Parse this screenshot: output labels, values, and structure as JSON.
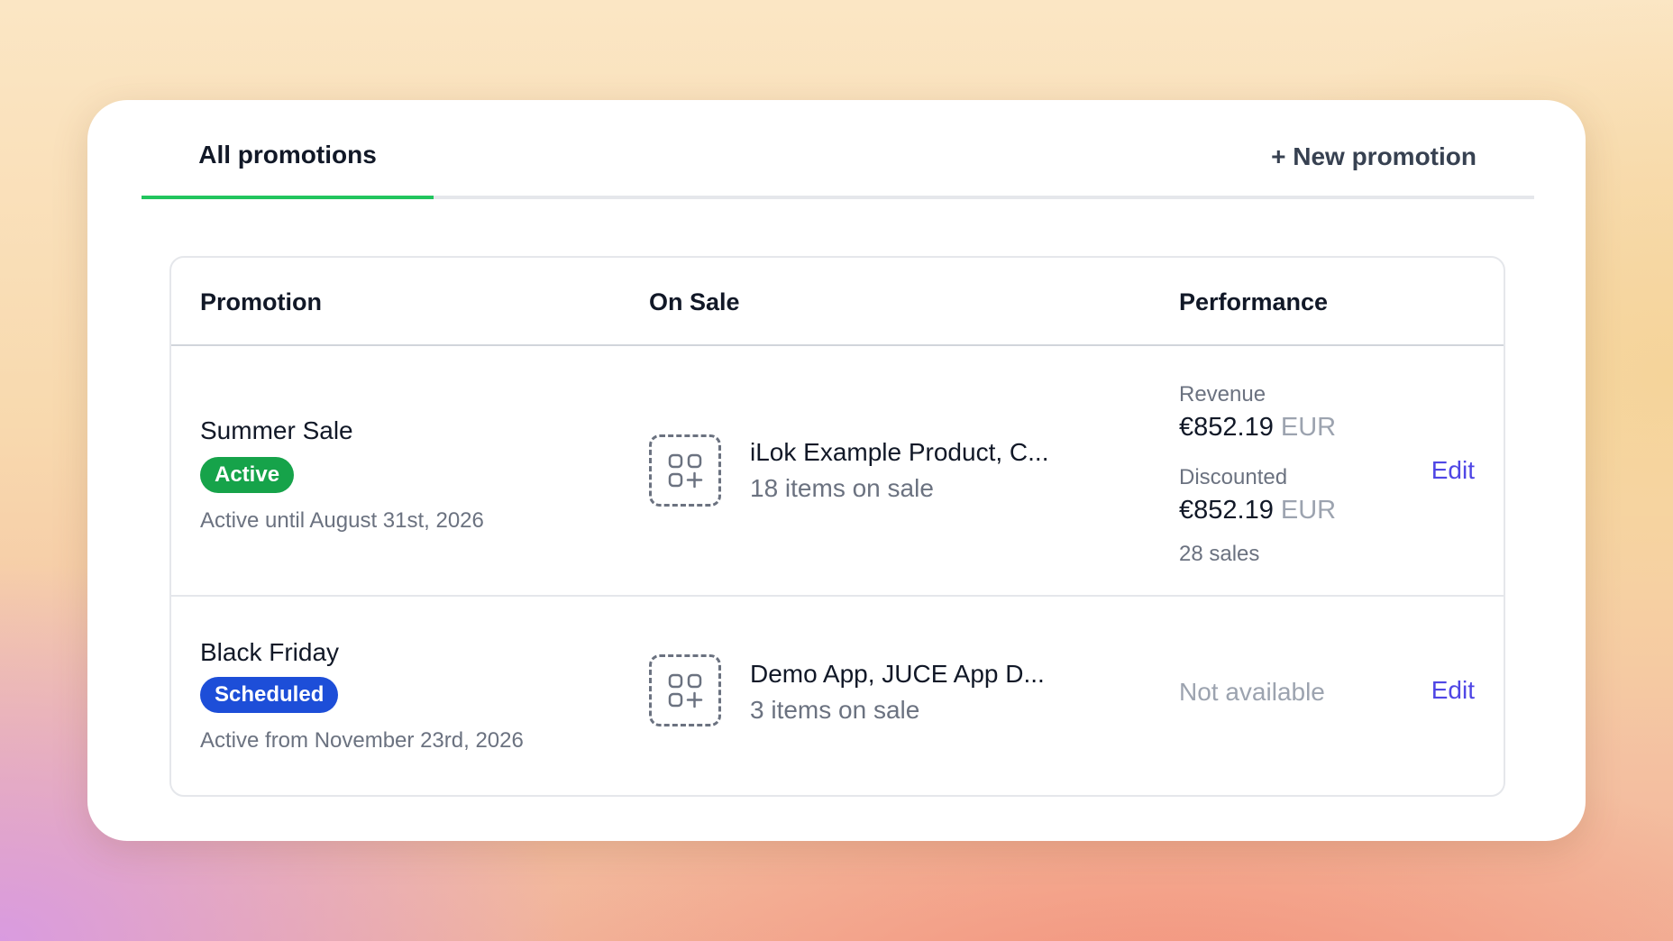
{
  "tabs": {
    "active_label": "All promotions",
    "new_promotion_label": "+ New promotion"
  },
  "table": {
    "headers": [
      "Promotion",
      "On Sale",
      "Performance"
    ],
    "rows": [
      {
        "name": "Summer Sale",
        "status": "Active",
        "status_color": "#16a34a",
        "date_text": "Active until August 31st, 2026",
        "product_icon": "add-grid-icon",
        "products": "iLok Example Product, C...",
        "items_on_sale": "18 items on sale",
        "revenue_label": "Revenue",
        "revenue_amount": "€852.19",
        "revenue_currency": "EUR",
        "discounted_label": "Discounted",
        "discounted_amount": "€852.19",
        "discounted_currency": "EUR",
        "sales": "28 sales",
        "edit_label": "Edit"
      },
      {
        "name": "Black Friday",
        "status": "Scheduled",
        "status_color": "#1d4ed8",
        "date_text": "Active from November 23rd, 2026",
        "product_icon": "add-grid-icon",
        "products": "Demo App, JUCE App D...",
        "items_on_sale": "3 items on sale",
        "performance_text": "Not available",
        "edit_label": "Edit"
      }
    ]
  },
  "colors": {
    "accent_tab": "#22c55e",
    "link": "#4f46e5"
  }
}
